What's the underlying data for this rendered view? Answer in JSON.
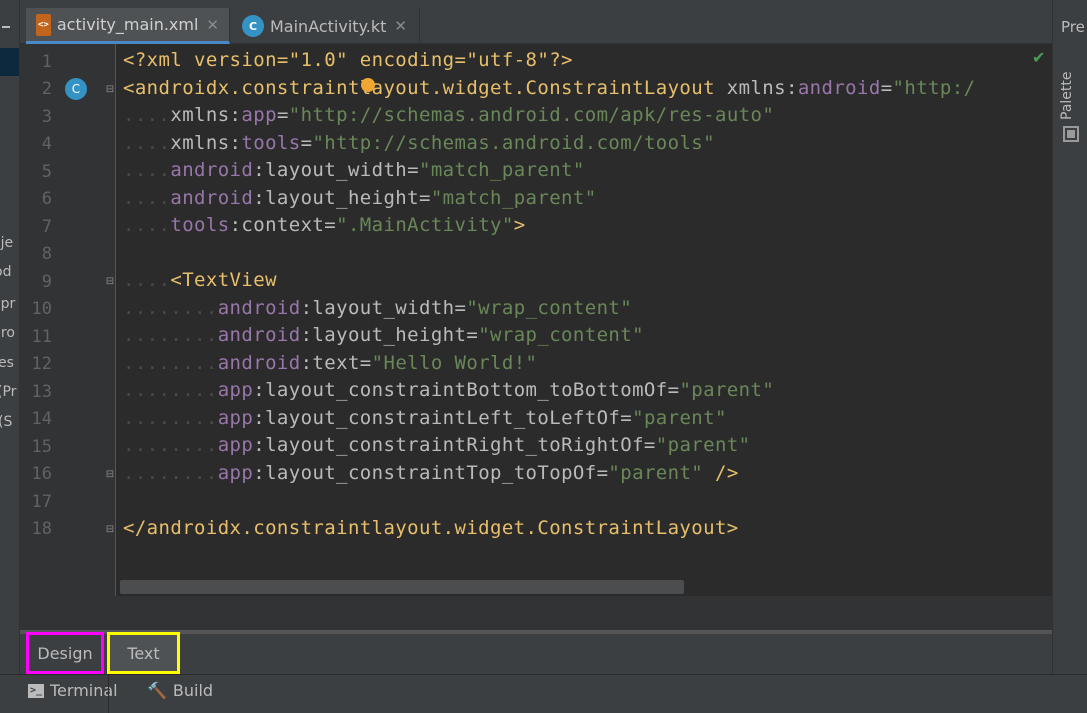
{
  "tabs": [
    {
      "label": "activity_main.xml",
      "icon": "xml-file-icon",
      "active": true
    },
    {
      "label": "MainActivity.kt",
      "icon": "kotlin-class-icon",
      "active": false
    }
  ],
  "left_panel": {
    "fragments": [
      "j",
      "oje",
      "od",
      "apr",
      "pro",
      "es",
      "(Pr",
      "(S"
    ]
  },
  "right_panel": {
    "top_label": "Pre",
    "palette_label": "Palette"
  },
  "editor": {
    "line_numbers": [
      "1",
      "2",
      "3",
      "4",
      "5",
      "6",
      "7",
      "8",
      "9",
      "10",
      "11",
      "12",
      "13",
      "14",
      "15",
      "16",
      "17",
      "18"
    ],
    "code": {
      "l1": "<?xml version=\"1.0\" encoding=\"utf-8\"?>",
      "l2_tag": "<androidx.constraintlayout.widget.ConstraintLayout",
      "l2_attr": " xmlns:",
      "l2_ns": "android",
      "l2_eq": "=",
      "l2_str": "\"http:/",
      "l3_attr": "xmlns:",
      "l3_ns": "app",
      "l3_str": "\"http://schemas.android.com/apk/res-auto\"",
      "l4_attr": "xmlns:",
      "l4_ns": "tools",
      "l4_str": "\"http://schemas.android.com/tools\"",
      "l5_ns": "android",
      "l5_attr": ":layout_width=",
      "l5_str": "\"match_parent\"",
      "l6_ns": "android",
      "l6_attr": ":layout_height=",
      "l6_str": "\"match_parent\"",
      "l7_ns": "tools",
      "l7_attr": ":context=",
      "l7_str": "\".MainActivity\"",
      "l7_end": ">",
      "l9_tag": "<TextView",
      "l10_ns": "android",
      "l10_attr": ":layout_width=",
      "l10_str": "\"wrap_content\"",
      "l11_ns": "android",
      "l11_attr": ":layout_height=",
      "l11_str": "\"wrap_content\"",
      "l12_ns": "android",
      "l12_attr": ":text=",
      "l12_str": "\"Hello World!\"",
      "l13_ns": "app",
      "l13_attr": ":layout_constraintBottom_toBottomOf=",
      "l13_str": "\"parent\"",
      "l14_ns": "app",
      "l14_attr": ":layout_constraintLeft_toLeftOf=",
      "l14_str": "\"parent\"",
      "l15_ns": "app",
      "l15_attr": ":layout_constraintRight_toRightOf=",
      "l15_str": "\"parent\"",
      "l16_ns": "app",
      "l16_attr": ":layout_constraintTop_toTopOf=",
      "l16_str": "\"parent\"",
      "l16_end": " />",
      "l18_tag": "</androidx.constraintlayout.widget.ConstraintLayout>"
    }
  },
  "mode_tabs": {
    "design": "Design",
    "text": "Text"
  },
  "status_bar": {
    "terminal": "Terminal",
    "build": "Build"
  },
  "colors": {
    "tag": "#e8bf6a",
    "namespace": "#9876aa",
    "string": "#6a8759",
    "design_highlight": "#ff00ff",
    "text_highlight": "#ffff00"
  }
}
